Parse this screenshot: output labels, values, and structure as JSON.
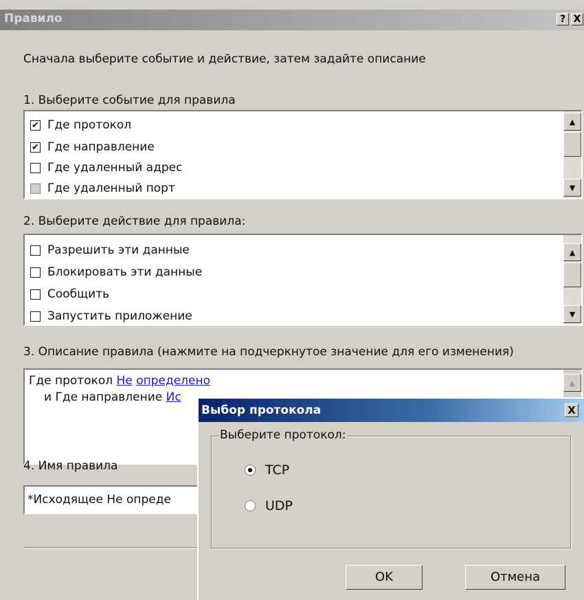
{
  "window": {
    "title": "Правило",
    "help_btn": "?",
    "close_btn": "X"
  },
  "instruction": "Сначала выберите событие и действие, затем задайте описание",
  "section1": {
    "label": "1. Выберите событие для правила",
    "items": [
      {
        "label": "Где протокол",
        "checked": true
      },
      {
        "label": "Где направление",
        "checked": true
      },
      {
        "label": "Где удаленный адрес",
        "checked": false
      },
      {
        "label": "Где удаленный порт",
        "checked": false
      }
    ]
  },
  "section2": {
    "label": "2. Выберите действие для правила:",
    "items": [
      {
        "label": "Разрешить эти данные",
        "checked": false
      },
      {
        "label": "Блокировать эти данные",
        "checked": false
      },
      {
        "label": "Сообщить",
        "checked": false
      },
      {
        "label": "Запустить приложение",
        "checked": false
      }
    ]
  },
  "section3": {
    "label": "3. Описание правила (нажмите на подчеркнутое значение для его изменения)",
    "line1_text": "Где протокол",
    "line1_link1": "Не",
    "line1_link2": "определено",
    "line2_text": "и Где направление",
    "line2_link": "Ис"
  },
  "section4": {
    "label": "4. Имя правила",
    "value": "*Исходящее Не опреде"
  },
  "popup": {
    "title": "Выбор протокола",
    "close": "X",
    "group_label": "Выберите протокол:",
    "options": [
      {
        "label": "TCP",
        "selected": true
      },
      {
        "label": "UDP",
        "selected": false
      }
    ],
    "ok": "OK",
    "cancel": "Отмена"
  }
}
